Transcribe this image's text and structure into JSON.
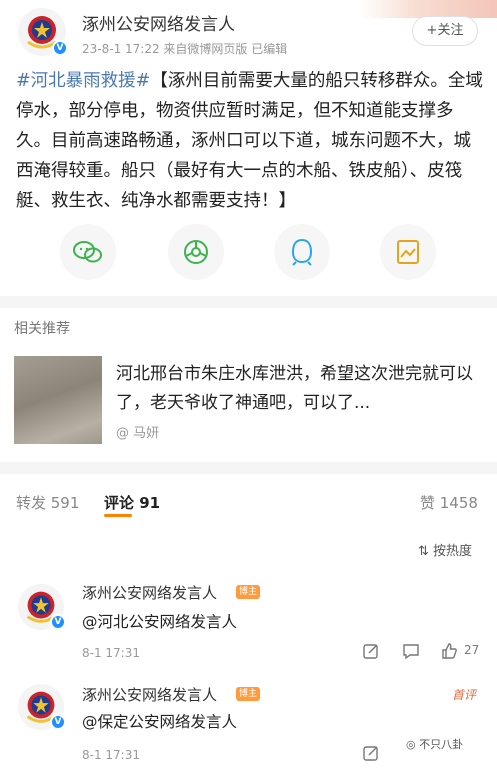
{
  "post": {
    "author": "涿州公安网络发言人",
    "meta": "23-8-1 17:22  来自微博网页版 已编辑",
    "follow_label": "+关注",
    "hashtag": "#河北暴雨救援#",
    "body": "【涿州目前需要大量的船只转移群众。全域停水，部分停电，物资供应暂时满足，但不知道能支撑多久。目前高速路畅通，涿州口可以下道，城东问题不大，城西淹得较重。船只（最好有大一点的木船、铁皮船）、皮筏艇、救生衣、纯净水都需要支持！】"
  },
  "share_buttons": [
    {
      "icon": "wechat-icon"
    },
    {
      "icon": "moments-icon"
    },
    {
      "icon": "qq-icon"
    },
    {
      "icon": "save-image-icon"
    }
  ],
  "related": {
    "title": "相关推荐",
    "item_text": "河北邢台市朱庄水库泄洪，希望这次泄完就可以了，老天爷收了神通吧，可以了...",
    "item_author": "@ 马妍"
  },
  "tabs": {
    "repost": "转发 591",
    "comments": "评论 91",
    "likes": "赞 1458"
  },
  "sort_label": "按热度",
  "comments": [
    {
      "name": "涿州公安网络发言人",
      "badge": "博主",
      "text": "@河北公安网络发言人",
      "time": "8-1 17:31",
      "likes": "27"
    },
    {
      "name": "涿州公安网络发言人",
      "badge": "博主",
      "text": "@保定公安网络发言人",
      "time": "8-1 17:31",
      "likes": ""
    }
  ],
  "first_comment_label": "首评",
  "watermark": "不只八卦",
  "colors": {
    "accent": "#ff8200",
    "link": "#4a78b4",
    "verified": "#1e90ff"
  }
}
